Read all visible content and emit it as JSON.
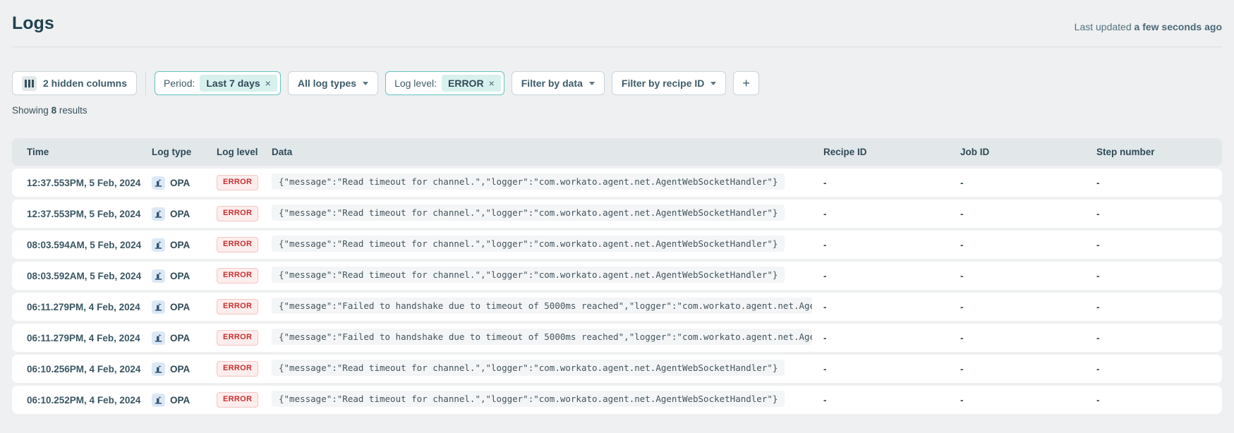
{
  "page": {
    "title": "Logs",
    "last_updated_prefix": "Last updated",
    "last_updated_value": "a few seconds ago"
  },
  "toolbar": {
    "hidden_columns_label": "2 hidden columns",
    "period_label": "Period:",
    "period_value": "Last 7 days",
    "period_remove": "×",
    "log_types_label": "All log types",
    "log_level_label": "Log level:",
    "log_level_value": "ERROR",
    "log_level_remove": "×",
    "filter_by_data_label": "Filter by data",
    "filter_by_recipe_label": "Filter by recipe ID",
    "add_filter_label": "+"
  },
  "results": {
    "prefix": "Showing",
    "count": "8",
    "suffix": "results"
  },
  "table": {
    "columns": [
      "Time",
      "Log type",
      "Log level",
      "Data",
      "Recipe ID",
      "Job ID",
      "Step number"
    ],
    "rows": [
      {
        "time": "12:37.553PM, 5 Feb, 2024",
        "log_type": "OPA",
        "log_level": "ERROR",
        "data": "{\"message\":\"Read timeout for channel.\",\"logger\":\"com.workato.agent.net.AgentWebSocketHandler\"}",
        "recipe_id": "-",
        "job_id": "-",
        "step_number": "-"
      },
      {
        "time": "12:37.553PM, 5 Feb, 2024",
        "log_type": "OPA",
        "log_level": "ERROR",
        "data": "{\"message\":\"Read timeout for channel.\",\"logger\":\"com.workato.agent.net.AgentWebSocketHandler\"}",
        "recipe_id": "-",
        "job_id": "-",
        "step_number": "-"
      },
      {
        "time": "08:03.594AM, 5 Feb, 2024",
        "log_type": "OPA",
        "log_level": "ERROR",
        "data": "{\"message\":\"Read timeout for channel.\",\"logger\":\"com.workato.agent.net.AgentWebSocketHandler\"}",
        "recipe_id": "-",
        "job_id": "-",
        "step_number": "-"
      },
      {
        "time": "08:03.592AM, 5 Feb, 2024",
        "log_type": "OPA",
        "log_level": "ERROR",
        "data": "{\"message\":\"Read timeout for channel.\",\"logger\":\"com.workato.agent.net.AgentWebSocketHandler\"}",
        "recipe_id": "-",
        "job_id": "-",
        "step_number": "-"
      },
      {
        "time": "06:11.279PM, 4 Feb, 2024",
        "log_type": "OPA",
        "log_level": "ERROR",
        "data": "{\"message\":\"Failed to handshake due to timeout of 5000ms reached\",\"logger\":\"com.workato.agent.net.Age…",
        "recipe_id": "-",
        "job_id": "-",
        "step_number": "-"
      },
      {
        "time": "06:11.279PM, 4 Feb, 2024",
        "log_type": "OPA",
        "log_level": "ERROR",
        "data": "{\"message\":\"Failed to handshake due to timeout of 5000ms reached\",\"logger\":\"com.workato.agent.net.Age…",
        "recipe_id": "-",
        "job_id": "-",
        "step_number": "-"
      },
      {
        "time": "06:10.256PM, 4 Feb, 2024",
        "log_type": "OPA",
        "log_level": "ERROR",
        "data": "{\"message\":\"Read timeout for channel.\",\"logger\":\"com.workato.agent.net.AgentWebSocketHandler\"}",
        "recipe_id": "-",
        "job_id": "-",
        "step_number": "-"
      },
      {
        "time": "06:10.252PM, 4 Feb, 2024",
        "log_type": "OPA",
        "log_level": "ERROR",
        "data": "{\"message\":\"Read timeout for channel.\",\"logger\":\"com.workato.agent.net.AgentWebSocketHandler\"}",
        "recipe_id": "-",
        "job_id": "-",
        "step_number": "-"
      }
    ]
  },
  "colors": {
    "page_background": "#eef0f1",
    "title_text": "#21424e",
    "accent_teal_border": "#67c3c0",
    "accent_teal_fill": "#d8f1ee",
    "error_text": "#c53030",
    "error_fill": "#fdedec",
    "error_border": "#f2c7c3",
    "header_row_fill": "#e2e7ea",
    "row_fill": "#ffffff",
    "opa_icon_fill": "#dbe8f6"
  }
}
